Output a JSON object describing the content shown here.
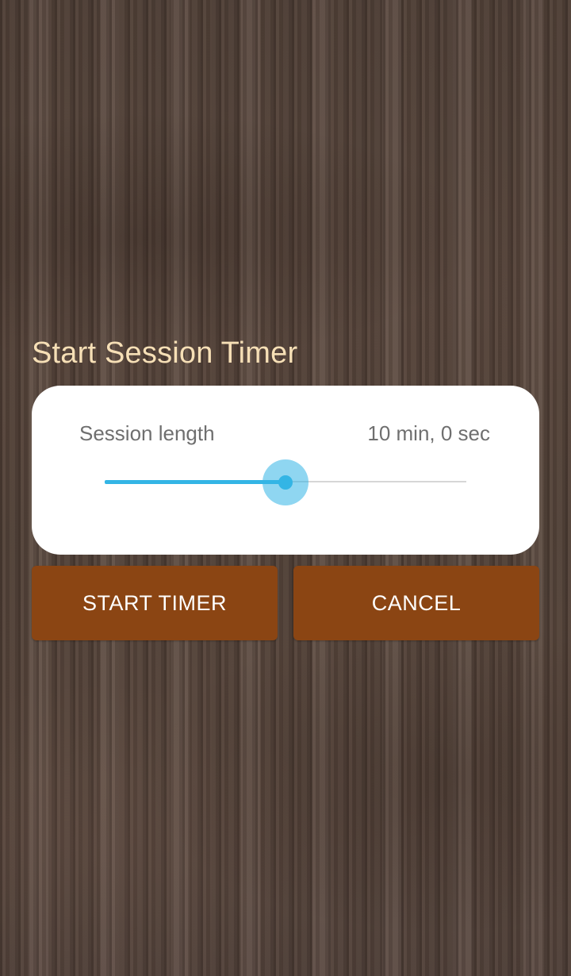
{
  "dialog": {
    "title": "Start Session Timer",
    "setting_label": "Session length",
    "setting_value": "10 min, 0 sec",
    "slider": {
      "fraction": 0.5,
      "accent_color": "#33b5e5"
    }
  },
  "buttons": {
    "start_label": "START TIMER",
    "cancel_label": "CANCEL",
    "color": "#8b4513"
  },
  "theme": {
    "title_color": "#f6dfb6",
    "background": "wood-texture-brown"
  }
}
